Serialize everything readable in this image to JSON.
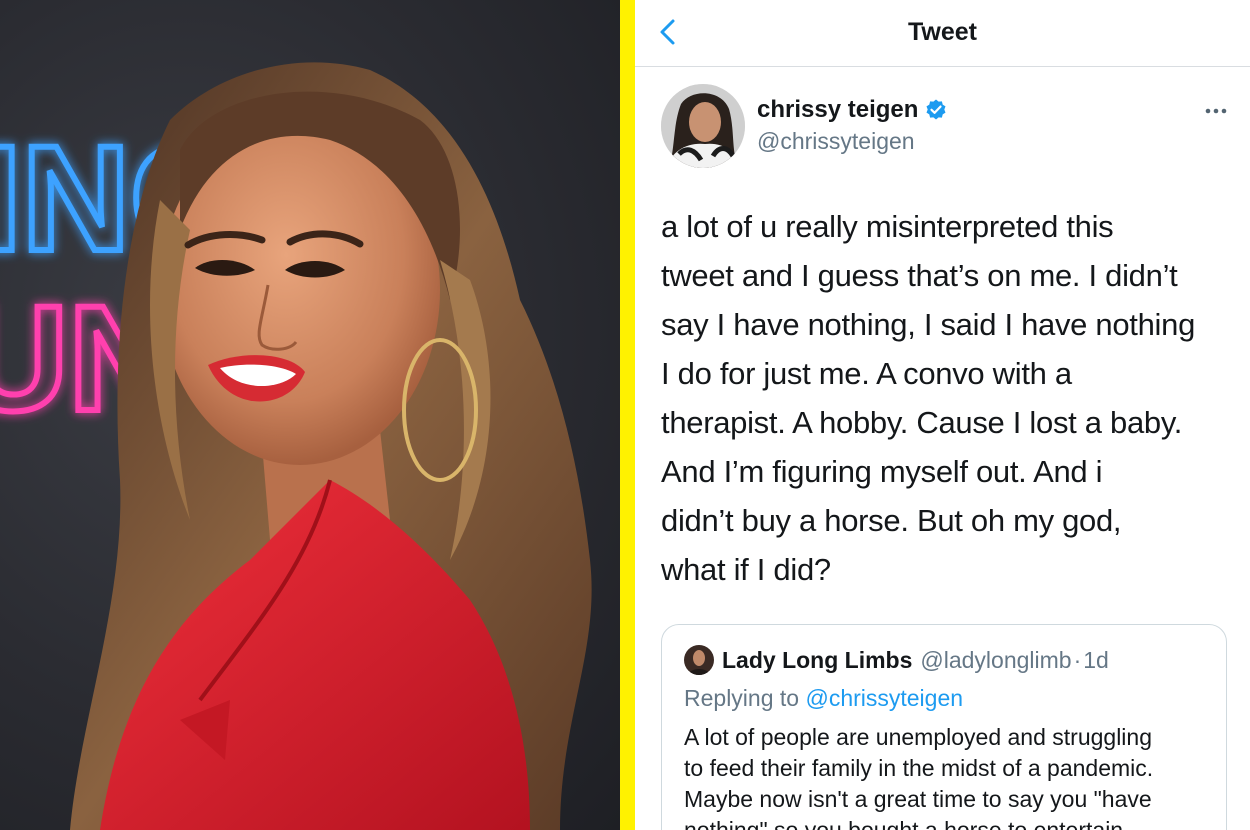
{
  "topbar": {
    "title": "Tweet",
    "back_icon": "chevron-left-icon"
  },
  "colors": {
    "divider": "#fff200",
    "twitter_blue": "#1d9bf0",
    "verified": "#1d9bf0",
    "text_primary": "#14171a",
    "text_secondary": "#657786",
    "neon_blue": "#3ea2ff",
    "neon_pink": "#ff3fae",
    "jacket_red": "#e51d2a"
  },
  "photo": {
    "neon_sign_lines": [
      "INC",
      "UNI"
    ]
  },
  "tweet": {
    "author_name": "chrissy teigen",
    "verified_icon": "verified-badge-icon",
    "handle": "@chrissyteigen",
    "more_icon": "more-options-icon",
    "text": "a lot of u really misinterpreted this\ntweet and I guess that’s on me. I didn’t\nsay I have nothing, I said I have nothing\nI do for just me. A convo with a\ntherapist. A hobby. Cause I lost a baby.\nAnd I’m figuring myself out. And i\ndidn’t buy a horse. But oh my god,\nwhat if I did?"
  },
  "quoted_tweet": {
    "author_name": "Lady Long Limbs",
    "handle": "@ladylonglimb",
    "separator": "·",
    "time": "1d",
    "replying_prefix": "Replying to",
    "replying_handle": "@chrissyteigen",
    "text": "A lot of people are unemployed and struggling\nto feed their family in the midst of a pandemic.\nMaybe now isn't a great time to say you \"have\nnothing\" so you bought a horse to entertain"
  }
}
